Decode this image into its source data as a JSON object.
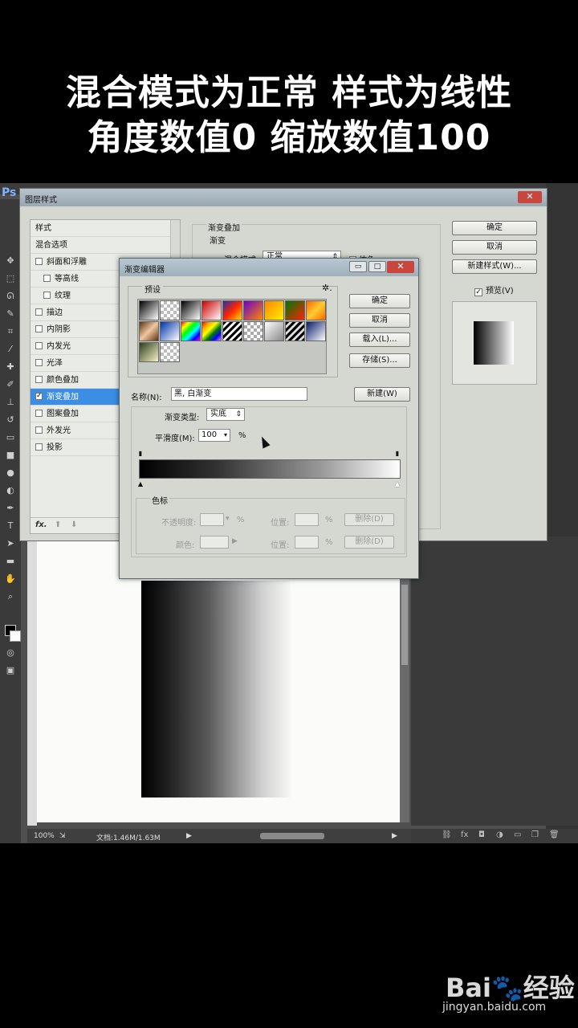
{
  "caption": {
    "line1": "混合模式为正常 样式为线性",
    "line2": "角度数值0 缩放数值100"
  },
  "app": {
    "logo": "Ps"
  },
  "layer_style": {
    "title": "图层样式",
    "close_glyph": "✕",
    "list_header": "样式",
    "blend_options": "混合选项",
    "items": [
      {
        "label": "斜面和浮雕",
        "checked": false
      },
      {
        "label": "等高线",
        "checked": false
      },
      {
        "label": "纹理",
        "checked": false
      },
      {
        "label": "描边",
        "checked": false
      },
      {
        "label": "内阴影",
        "checked": false
      },
      {
        "label": "内发光",
        "checked": false
      },
      {
        "label": "光泽",
        "checked": false
      },
      {
        "label": "颜色叠加",
        "checked": false
      },
      {
        "label": "渐变叠加",
        "checked": true
      },
      {
        "label": "图案叠加",
        "checked": false
      },
      {
        "label": "外发光",
        "checked": false
      },
      {
        "label": "投影",
        "checked": false
      }
    ],
    "fx_label": "fx.",
    "panel_title": "渐变叠加",
    "panel_sub": "渐变",
    "blend_mode_label": "混合模式:",
    "blend_mode_value": "正常",
    "dither_label": "仿色",
    "ok": "确定",
    "cancel": "取消",
    "new_style": "新建样式(W)...",
    "preview_label": "预览(V)",
    "preview_checked": "✓"
  },
  "gradient_editor": {
    "title": "渐变编辑器",
    "presets_label": "预设",
    "gear": "✲.",
    "ok": "确定",
    "cancel": "取消",
    "load": "载入(L)...",
    "save": "存储(S)...",
    "name_label": "名称(N):",
    "name_value": "黑, 白渐变",
    "new": "新建(W)",
    "type_label": "渐变类型:",
    "type_value": "实底",
    "smoothness_label": "平滑度(M):",
    "smoothness_value": "100",
    "percent": "%",
    "stops_label": "色标",
    "opacity_label": "不透明度:",
    "location_label": "位置:",
    "delete_label": "删除(D)",
    "color_label": "颜色:",
    "location_label2": "位置:",
    "delete_label2": "删除(D)",
    "select_arrow": "⇕"
  },
  "status": {
    "zoom": "100%",
    "doc": "文档:1.46M/1.63M"
  },
  "watermark": {
    "logo": "Bai🐾经验",
    "url": "jingyan.baidu.com"
  }
}
